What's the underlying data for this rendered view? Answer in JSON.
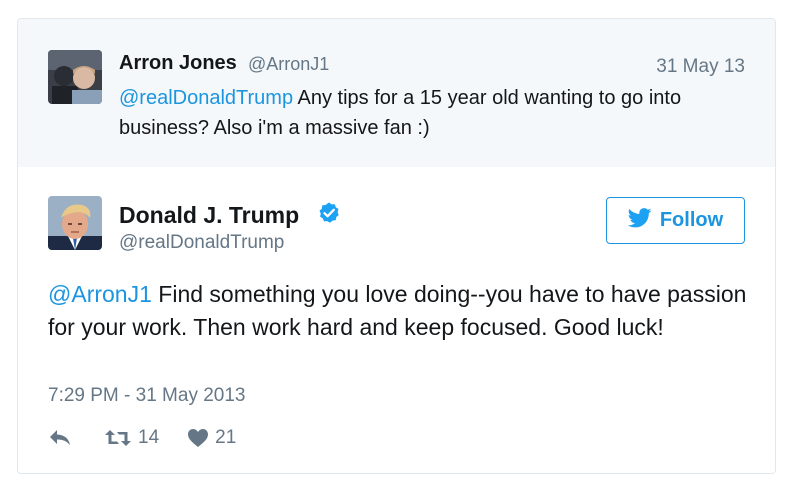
{
  "parent_tweet": {
    "author_name": "Arron Jones",
    "author_handle": "@ArronJ1",
    "date": "31 May 13",
    "mention": "@realDonaldTrump",
    "text_line1": " Any tips for a 15 year old wanting to go into",
    "text_line2": "business? Also i'm a massive fan :)"
  },
  "main_tweet": {
    "author_name": "Donald J. Trump",
    "author_handle": "@realDonaldTrump",
    "follow_label": "Follow",
    "mention": "@ArronJ1",
    "text": " Find something you love doing--you have to have passion for your work. Then work hard and keep focused. Good luck!",
    "timestamp": "7:29 PM - 31 May 2013",
    "retweet_count": "14",
    "like_count": "21"
  },
  "colors": {
    "link": "#1b95e0",
    "muted": "#657786",
    "parent_bg": "#f5f8fa"
  },
  "icons": [
    "reply-icon",
    "retweet-icon",
    "heart-icon",
    "verified-icon",
    "twitter-bird-icon"
  ]
}
